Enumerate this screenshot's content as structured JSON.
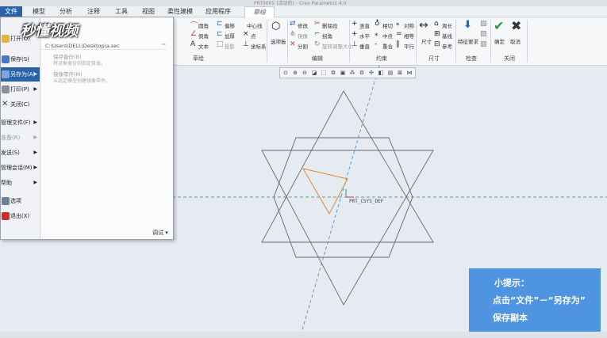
{
  "window": {
    "title": "PRT0005 (活动的) - Creo Parametric 4.0"
  },
  "menu_tabs": [
    "文件",
    "模型",
    "分析",
    "注释",
    "工具",
    "视图",
    "柔性建模",
    "应用程序",
    "草绘"
  ],
  "ribbon": {
    "items": [
      "圆角",
      "偏移",
      "中心线",
      "倒角",
      "加厚",
      "点",
      "文本",
      "投影",
      "坐标系",
      "选项板",
      "修改",
      "删除段",
      "镜像",
      "拐角",
      "分割",
      "旋转调整大小",
      "竖直",
      "相切",
      "对称",
      "水平",
      "中点",
      "相等",
      "垂直",
      "重合",
      "平行",
      "尺寸",
      "周长",
      "基线",
      "参考",
      "特征要求",
      "确定",
      "取消"
    ],
    "groups": [
      "草绘",
      "编辑",
      "约束",
      "尺寸",
      "检查",
      "关闭"
    ]
  },
  "file_menu": {
    "items": [
      {
        "label": "打开(O)",
        "has_submenu": false
      },
      {
        "label": "保存(S)",
        "has_submenu": false
      },
      {
        "label": "另存为(A)",
        "has_submenu": true
      },
      {
        "label": "打印(P)",
        "has_submenu": true
      },
      {
        "label": "关闭(C)",
        "has_submenu": false
      },
      {
        "label": "管理文件(F)",
        "has_submenu": true
      },
      {
        "label": "准备(R)",
        "has_submenu": true
      },
      {
        "label": "发送(S)",
        "has_submenu": true
      },
      {
        "label": "管理会话(M)",
        "has_submenu": true
      },
      {
        "label": "帮助",
        "has_submenu": true
      },
      {
        "label": "选项",
        "has_submenu": false
      },
      {
        "label": "退出(X)",
        "has_submenu": false
      }
    ],
    "recent_path": "C:\\Users\\DELL\\Desktop\\a.sec",
    "submenu_items": [
      {
        "title": "保存备份(B)",
        "desc": "将对象备份到指定目录。"
      },
      {
        "title": "镜像零件(M)",
        "desc": "从选定模型创建镜像零件。"
      }
    ],
    "debug_label": "调试 ▾"
  },
  "canvas": {
    "csys_label": "PRT_CSYS_DEF"
  },
  "watermark": "秒懂视频",
  "tip": {
    "title": "小提示：",
    "line1": "点击“文件”－“另存为”",
    "line2": "保存副本"
  }
}
